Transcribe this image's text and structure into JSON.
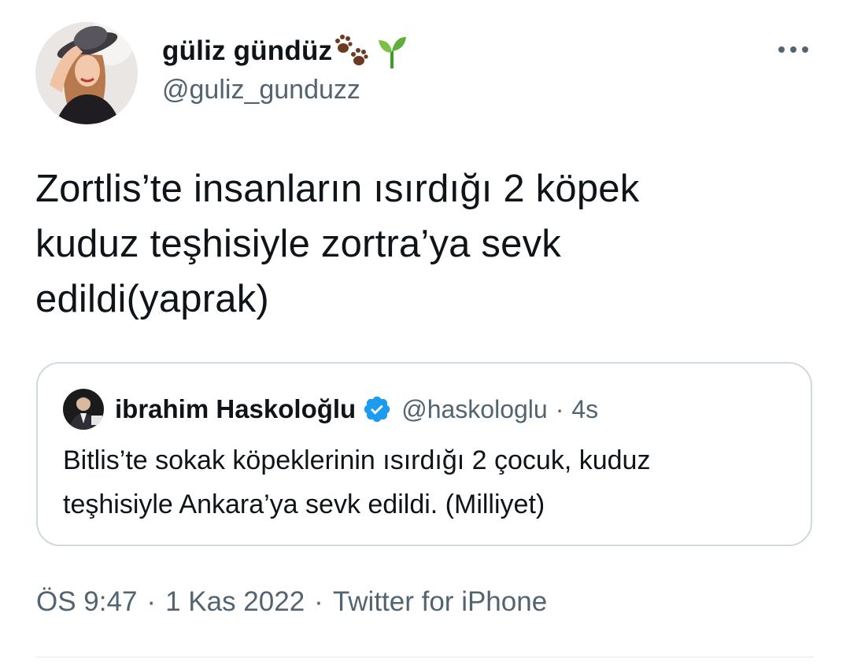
{
  "author": {
    "display_name": "güliz gündüz",
    "name_emoji": [
      "paw-prints-icon",
      "seedling-icon"
    ],
    "handle": "@guliz_gunduzz",
    "more_icon": "more-horizontal-icon"
  },
  "tweet": {
    "text": "Zortlis’te insanların ısırdığı 2 köpek\nkuduz teşhisiyle zortra’ya sevk\nedildi(yaprak)"
  },
  "quoted_tweet": {
    "display_name": "ibrahim Haskoloğlu",
    "verified_icon": "verified-badge-icon",
    "handle": "@haskologlu",
    "separator": "·",
    "time": "4s",
    "text": "Bitlis’te sokak köpeklerinin ısırdığı 2 çocuk, kuduz\nteşhisiyle Ankara’ya sevk edildi. (Milliyet)"
  },
  "meta": {
    "time": "ÖS 9:47",
    "separator": "·",
    "date": "1 Kas 2022",
    "source": "Twitter for iPhone"
  },
  "colors": {
    "text_primary": "#0f1419",
    "text_secondary": "#536471",
    "border": "#cfd9de",
    "divider": "#eff3f4",
    "verified_blue": "#1d9bf0"
  }
}
